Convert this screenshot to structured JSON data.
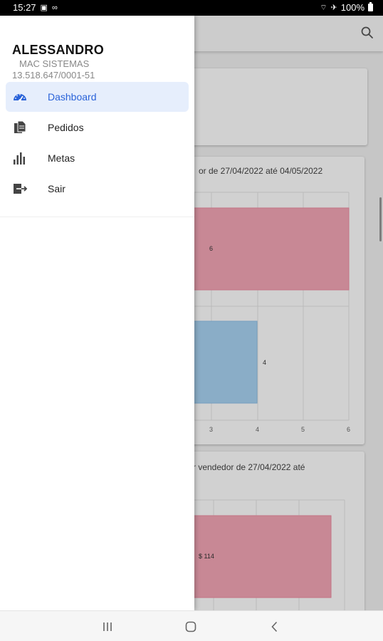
{
  "status_bar": {
    "time": "15:27",
    "battery": "100%",
    "icons": [
      "image-icon",
      "voicemail-icon",
      "wifi-icon",
      "airplane-icon",
      "battery-icon"
    ]
  },
  "drawer": {
    "user_name": "ALESSANDRO",
    "company": "MAC SISTEMAS",
    "cnpj": "13.518.647/0001-51",
    "items": [
      {
        "label": "Dashboard",
        "icon": "speedometer-icon",
        "active": true
      },
      {
        "label": "Pedidos",
        "icon": "documents-icon",
        "active": false
      },
      {
        "label": "Metas",
        "icon": "bar-chart-icon",
        "active": false
      },
      {
        "label": "Sair",
        "icon": "exit-icon",
        "active": false
      }
    ]
  },
  "background": {
    "chart1_title": "or de 27/04/2022 até 04/05/2022",
    "chart2_title": "r vendedor de 27/04/2022 até",
    "colors": {
      "accent": "#2a63d9",
      "bar_red": "#f4a6b6",
      "bar_blue": "#a9d4f3"
    }
  },
  "chart_data": [
    {
      "type": "bar",
      "orientation": "horizontal",
      "title": "or de 27/04/2022 até 04/05/2022",
      "values": [
        6,
        4
      ],
      "value_labels": [
        "6",
        "4"
      ],
      "x_ticks": [
        "3",
        "4",
        "5",
        "6"
      ]
    },
    {
      "type": "bar",
      "orientation": "horizontal",
      "title": "r vendedor de 27/04/2022 até",
      "value_labels": [
        "$ 114"
      ]
    }
  ]
}
